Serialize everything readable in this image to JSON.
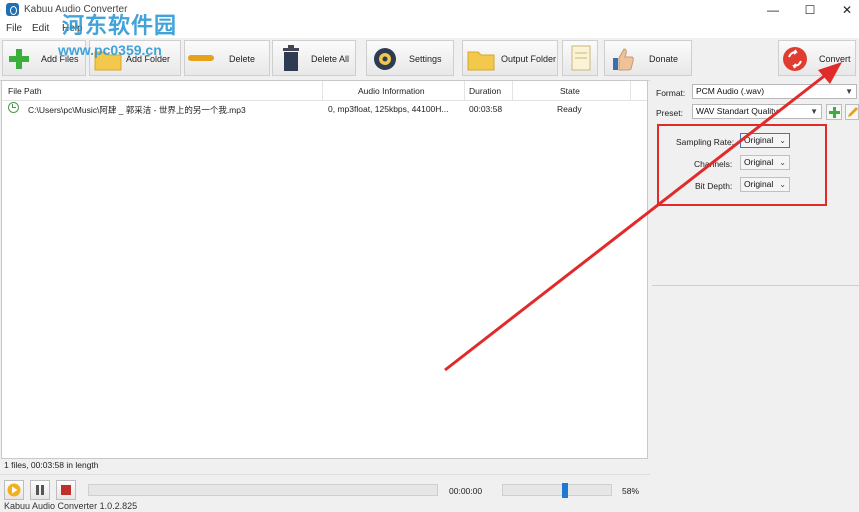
{
  "window": {
    "title": "Kabuu Audio Converter",
    "minimize": "—",
    "maximize": "☐",
    "close": "✕"
  },
  "menu": [
    {
      "label": "File"
    },
    {
      "label": "Edit"
    },
    {
      "label": "Help"
    }
  ],
  "watermark": {
    "name": "河东软件园",
    "url": "www.pc0359.cn"
  },
  "toolbar": {
    "add_files": "Add Files",
    "add_folder": "Add Folder",
    "delete": "Delete",
    "delete_all": "Delete All",
    "settings": "Settings",
    "output_folder": "Output Folder",
    "donate": "Donate",
    "convert": "Convert"
  },
  "file_list": {
    "columns": [
      "File Path",
      "Audio Information",
      "Duration",
      "State"
    ],
    "rows": [
      {
        "path": "C:\\Users\\pc\\Music\\阿肆 _ 郭采洁 - 世界上的另一个我.mp3",
        "info": "0, mp3float, 125kbps, 44100H...",
        "duration": "00:03:58",
        "state": "Ready"
      }
    ]
  },
  "status": "1 files, 00:03:58 in length",
  "player": {
    "time": "00:00:00",
    "volume_label": "58%",
    "volume": 0.58,
    "progress": 0
  },
  "settings": {
    "format_label": "Format:",
    "format_value": "PCM Audio (.wav)",
    "preset_label": "Preset:",
    "preset_value": "WAV Standart Quality",
    "sampling_rate_label": "Sampling Rate:",
    "sampling_rate_value": "Original",
    "channels_label": "Channels:",
    "channels_value": "Original",
    "bit_depth_label": "Bit Depth:",
    "bit_depth_value": "Original"
  },
  "footer": {
    "version": "Kabuu Audio Converter 1.0.2.825"
  },
  "colors": {
    "annotation_red": "#e12a2a",
    "accent_blue": "#1f78d1",
    "watermark_blue": "#2e9ad6"
  }
}
